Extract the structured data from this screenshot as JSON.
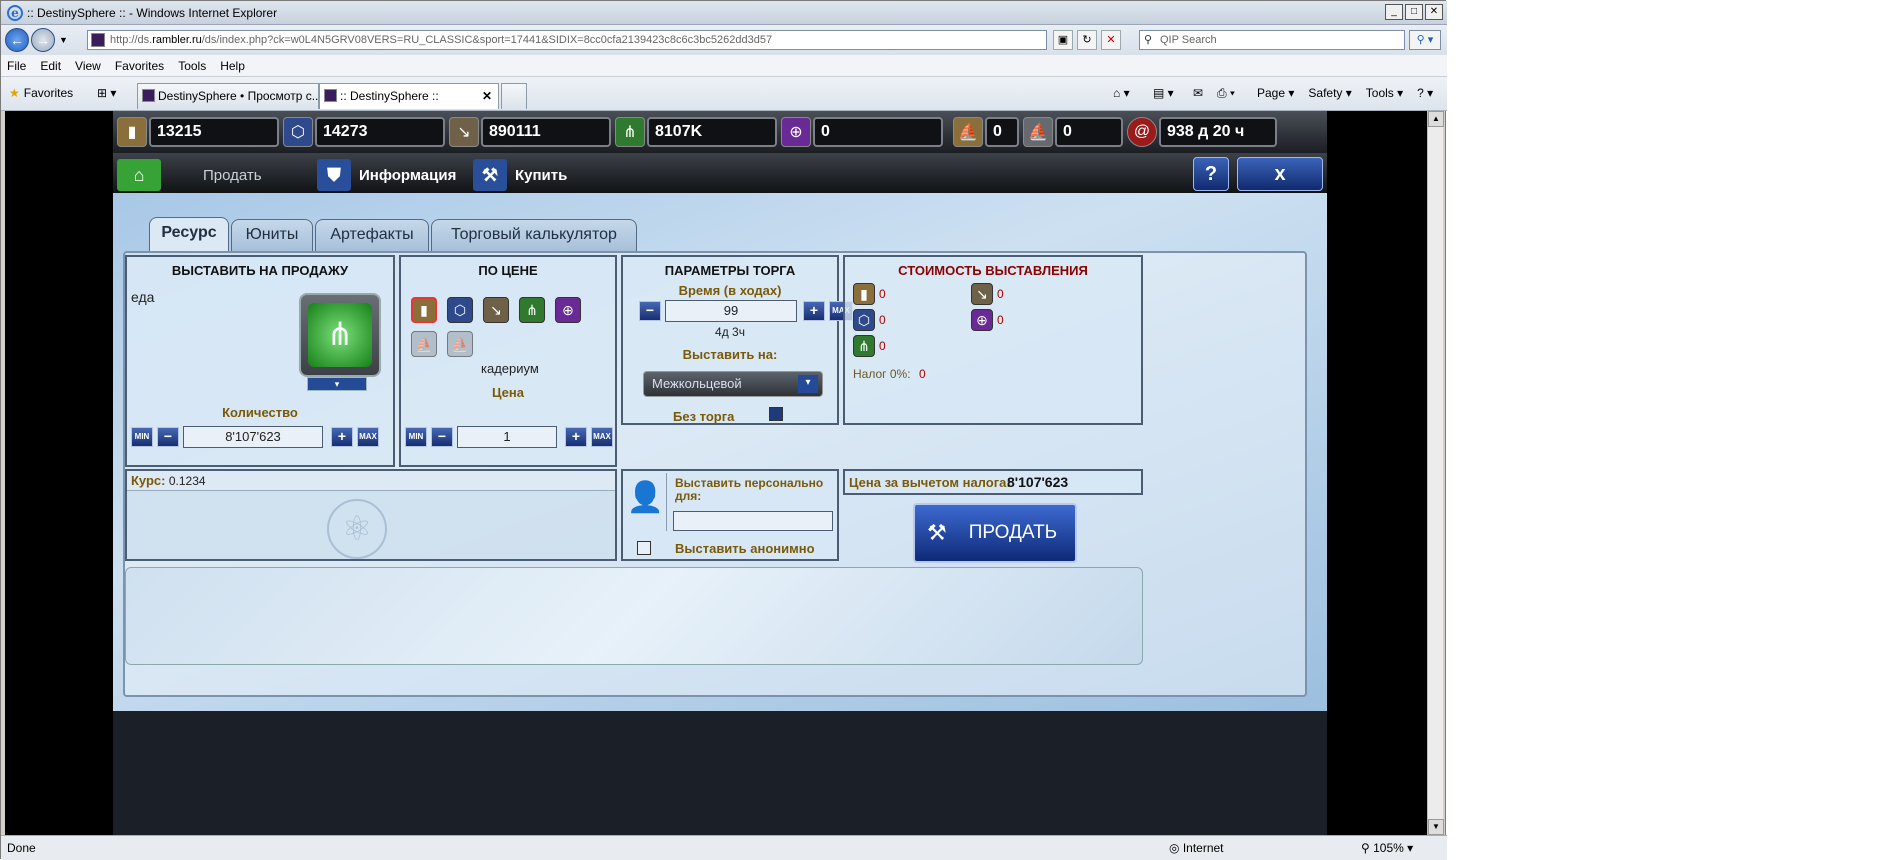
{
  "window": {
    "title": ":: DestinySphere :: - Windows Internet Explorer"
  },
  "address": {
    "prefix": "http://ds.",
    "host": "rambler.ru",
    "path": "/ds/index.php?ck=w0L4N5GRV08VERS=RU_CLASSIC&sport=17441&SIDIX=8cc0cfa2139423c8c6c3bc5262dd3d57"
  },
  "search": {
    "placeholder": "QIP Search"
  },
  "menu": [
    "File",
    "Edit",
    "View",
    "Favorites",
    "Tools",
    "Help"
  ],
  "favorites_label": "Favorites",
  "tabs": [
    {
      "label": "DestinySphere • Просмотр с..."
    },
    {
      "label": ":: DestinySphere ::"
    }
  ],
  "commands": [
    "Page ▾",
    "Safety ▾",
    "Tools ▾",
    "? ▾"
  ],
  "resources": [
    {
      "icon": "credits-icon",
      "value": "13215",
      "color": "#8a6f3a"
    },
    {
      "icon": "crystal-icon",
      "value": "14273",
      "color": "#2f4a8c"
    },
    {
      "icon": "cadmium-icon",
      "value": "890111",
      "color": "#6e6148"
    },
    {
      "icon": "food-icon",
      "value": "8107K",
      "color": "#2f7a2f"
    },
    {
      "icon": "energy-icon",
      "value": "0",
      "color": "#6a2a96"
    },
    {
      "icon": "ships-gold-icon",
      "value": "0",
      "color": "#8a6f3a"
    },
    {
      "icon": "ships-grey-icon",
      "value": "0",
      "color": "#666a70"
    },
    {
      "icon": "time-icon",
      "value": "938 д 20 ч",
      "color": "#9b1a1a"
    }
  ],
  "nav": {
    "sell": "Продать",
    "info": "Информация",
    "buy": "Купить",
    "help": "?",
    "close": "x"
  },
  "game_tabs": [
    "Ресурс",
    "Юниты",
    "Артефакты",
    "Торговый калькулятор"
  ],
  "sell_box": {
    "title": "ВЫСТАВИТЬ НА ПРОДАЖУ",
    "resource": "еда",
    "qty_label": "Количество",
    "qty_value": "8'107'623",
    "min": "MIN",
    "max": "MAX"
  },
  "price_box": {
    "title": "ПО ЦЕНЕ",
    "selected_resource": "кадериум",
    "price_label": "Цена",
    "price_value": "1"
  },
  "params_box": {
    "title": "ПАРАМЕТРЫ ТОРГА",
    "time_label": "Время (в ходах)",
    "time_value": "99",
    "time_sub": "4д 3ч",
    "place_label": "Выставить на:",
    "place_value": "Межкольцевой",
    "no_bargain": "Без торга"
  },
  "cost_box": {
    "title": "СТОИМОСТЬ ВЫСТАВЛЕНИЯ",
    "items": [
      "0",
      "0",
      "0",
      "0",
      "0"
    ],
    "tax_label": "Налог 0%:",
    "tax_value": "0"
  },
  "rate": {
    "label": "Курс:",
    "value": "0.1234"
  },
  "personal": {
    "label": "Выставить персонально для:",
    "value": "",
    "anon_label": "Выставить анонимно"
  },
  "net": {
    "label": "Цена за вычетом налога:",
    "value": "8'107'623"
  },
  "sell_button": "ПРОДАТЬ",
  "status": {
    "done": "Done",
    "zone": "Internet",
    "zoom": "105%"
  }
}
